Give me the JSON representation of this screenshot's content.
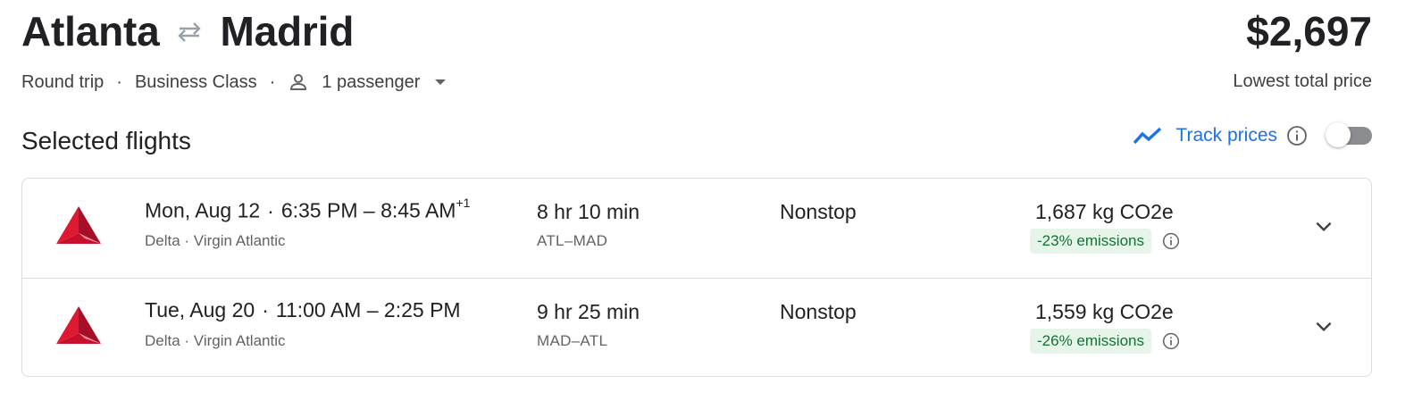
{
  "trip": {
    "origin": "Atlanta",
    "destination": "Madrid",
    "trip_type": "Round trip",
    "cabin_class": "Business Class",
    "passengers": "1 passenger",
    "icons": {
      "swap": "swap-arrows-icon",
      "passenger": "person-icon",
      "dropdown": "caret-down-icon"
    }
  },
  "price": {
    "amount": "$2,697",
    "label": "Lowest total price"
  },
  "section": {
    "title": "Selected flights"
  },
  "track": {
    "label": "Track prices",
    "enabled": false,
    "icons": {
      "trend": "trending-up-icon",
      "info": "info-icon"
    },
    "accent_color": "#1a73e8"
  },
  "flights": [
    {
      "day": "Mon, Aug 12",
      "sep": "·",
      "depart": "6:35 PM",
      "dash": "–",
      "arrive": "8:45 AM",
      "day_offset": "+1",
      "airlines": "Delta · Virgin Atlantic",
      "duration": "8 hr 10 min",
      "airports": "ATL–MAD",
      "stops": "Nonstop",
      "co2": "1,687 kg CO2e",
      "emissions": "-23% emissions"
    },
    {
      "day": "Tue, Aug 20",
      "sep": "·",
      "depart": "11:00 AM",
      "dash": "–",
      "arrive": "2:25 PM",
      "day_offset": "",
      "airlines": "Delta · Virgin Atlantic",
      "duration": "9 hr 25 min",
      "airports": "MAD–ATL",
      "stops": "Nonstop",
      "co2": "1,559 kg CO2e",
      "emissions": "-26% emissions"
    }
  ],
  "colors": {
    "delta_red": "#c8102e",
    "emissions_green_bg": "#e6f4ea",
    "emissions_green_text": "#137333"
  }
}
